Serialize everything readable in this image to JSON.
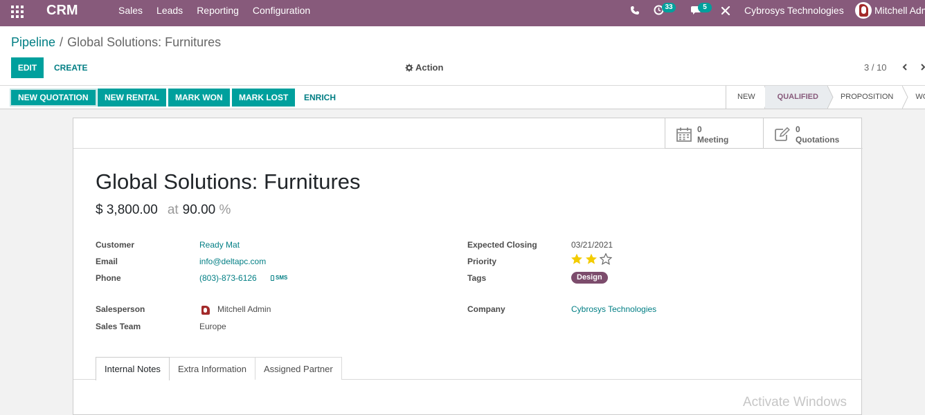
{
  "navbar": {
    "app_name": "CRM",
    "menu": [
      "Sales",
      "Leads",
      "Reporting",
      "Configuration"
    ],
    "activity_count": "33",
    "message_count": "5",
    "company": "Cybrosys Technologies",
    "user": "Mitchell Adm"
  },
  "breadcrumb": {
    "parent": "Pipeline",
    "separator": "/",
    "current": "Global Solutions: Furnitures"
  },
  "control": {
    "edit": "EDIT",
    "create": "CREATE",
    "action": "Action",
    "pager": "3 / 10"
  },
  "statusbar": {
    "buttons": [
      "NEW QUOTATION",
      "NEW RENTAL",
      "MARK WON",
      "MARK LOST",
      "ENRICH"
    ],
    "stages": [
      "NEW",
      "QUALIFIED",
      "PROPOSITION",
      "WON"
    ],
    "active_stage": "QUALIFIED"
  },
  "smart_buttons": [
    {
      "count": "0",
      "label": "Meeting",
      "icon": "calendar-icon"
    },
    {
      "count": "0",
      "label": "Quotations",
      "icon": "pencil-square-icon"
    }
  ],
  "lead": {
    "title": "Global Solutions: Furnitures",
    "revenue": "$ 3,800.00",
    "at": "at",
    "probability": "90.00",
    "percent": "%"
  },
  "fields": {
    "customer_label": "Customer",
    "customer": "Ready Mat",
    "email_label": "Email",
    "email": "info@deltapc.com",
    "phone_label": "Phone",
    "phone": "(803)-873-6126",
    "sms": "SMS",
    "salesperson_label": "Salesperson",
    "salesperson": "Mitchell Admin",
    "team_label": "Sales Team",
    "team": "Europe",
    "closing_label": "Expected Closing",
    "closing": "03/21/2021",
    "priority_label": "Priority",
    "priority_stars": 2,
    "priority_max": 3,
    "tags_label": "Tags",
    "tag": "Design",
    "company_label": "Company",
    "company": "Cybrosys Technologies"
  },
  "tabs": [
    "Internal Notes",
    "Extra Information",
    "Assigned Partner"
  ],
  "watermark": "Activate Windows",
  "colors": {
    "brand": "#875a7b",
    "primary": "#00a09d",
    "link": "#017e84",
    "star": "#f3cc00",
    "tag": "#7c4c6c"
  }
}
